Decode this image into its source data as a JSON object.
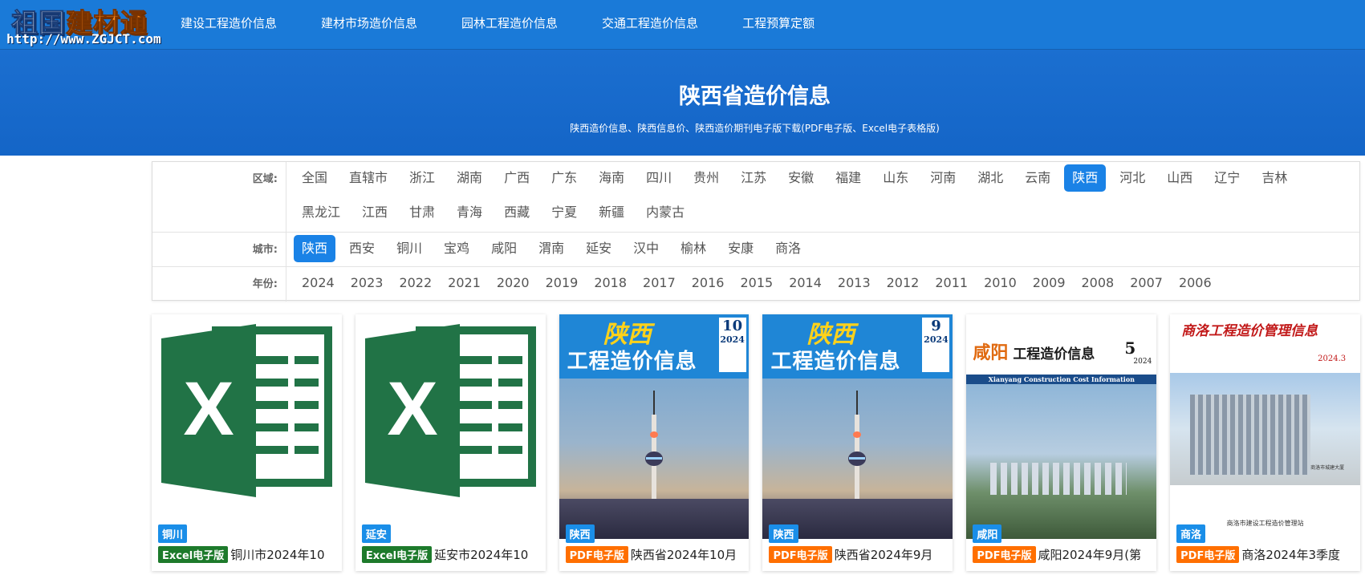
{
  "logo": {
    "cn_part1": "祖国",
    "cn_part2": "建材通",
    "url": "http://www.ZGJCT.com"
  },
  "nav": [
    {
      "label": "建设工程造价信息"
    },
    {
      "label": "建材市场造价信息"
    },
    {
      "label": "园林工程造价信息"
    },
    {
      "label": "交通工程造价信息"
    },
    {
      "label": "工程预算定额"
    }
  ],
  "banner": {
    "title": "陕西省造价信息",
    "subtitle": "陕西造价信息、陕西信息价、陕西造价期刊电子版下载(PDF电子版、Excel电子表格版)"
  },
  "filters": {
    "region": {
      "label": "区域:",
      "items": [
        "全国",
        "直辖市",
        "浙江",
        "湖南",
        "广西",
        "广东",
        "海南",
        "四川",
        "贵州",
        "江苏",
        "安徽",
        "福建",
        "山东",
        "河南",
        "湖北",
        "云南",
        "陕西",
        "河北",
        "山西",
        "辽宁",
        "吉林",
        "黑龙江",
        "江西",
        "甘肃",
        "青海",
        "西藏",
        "宁夏",
        "新疆",
        "内蒙古"
      ],
      "active": "陕西"
    },
    "city": {
      "label": "城市:",
      "items": [
        "陕西",
        "西安",
        "铜川",
        "宝鸡",
        "咸阳",
        "渭南",
        "延安",
        "汉中",
        "榆林",
        "安康",
        "商洛"
      ],
      "active": "陕西"
    },
    "year": {
      "label": "年份:",
      "items": [
        "2024",
        "2023",
        "2022",
        "2021",
        "2020",
        "2019",
        "2018",
        "2017",
        "2016",
        "2015",
        "2014",
        "2013",
        "2012",
        "2011",
        "2010",
        "2009",
        "2008",
        "2007",
        "2006"
      ]
    }
  },
  "cards": [
    {
      "cover": "excel",
      "city": "铜川",
      "type": "Excel电子版",
      "type_kind": "excel",
      "title": "铜川市2024年10"
    },
    {
      "cover": "excel",
      "city": "延安",
      "type": "Excel电子版",
      "type_kind": "excel",
      "title": "延安市2024年10"
    },
    {
      "cover": "shaanxi",
      "city": "陕西",
      "type": "PDF电子版",
      "type_kind": "pdf",
      "title": "陕西省2024年10月",
      "mag": {
        "title1": "陕西",
        "title2": "工程造价信息",
        "issue": "10",
        "year": "2024"
      }
    },
    {
      "cover": "shaanxi",
      "city": "陕西",
      "type": "PDF电子版",
      "type_kind": "pdf",
      "title": "陕西省2024年9月",
      "mag": {
        "title1": "陕西",
        "title2": "工程造价信息",
        "issue": "9",
        "year": "2024"
      }
    },
    {
      "cover": "xianyang",
      "city": "咸阳",
      "type": "PDF电子版",
      "type_kind": "pdf",
      "title": "咸阳2024年9月(第",
      "mag": {
        "title1": "咸阳",
        "title2": "工程造价信息",
        "issue": "5",
        "year": "2024",
        "en": "Xianyang Construction Cost Information"
      }
    },
    {
      "cover": "shangluo",
      "city": "商洛",
      "type": "PDF电子版",
      "type_kind": "pdf",
      "title": "商洛2024年3季度",
      "mag": {
        "title2": "商洛工程造价管理信息",
        "date": "2024.3",
        "footer": "商洛市建设工程造价管理站",
        "photo_caption": "商洛市城建大厦"
      }
    }
  ],
  "colors": {
    "header": "#1a7ad8",
    "active": "#1a82e6",
    "excel_badge": "#1d7a2b",
    "pdf_badge": "#ff6f00",
    "city_badge": "#1a8ee8"
  }
}
